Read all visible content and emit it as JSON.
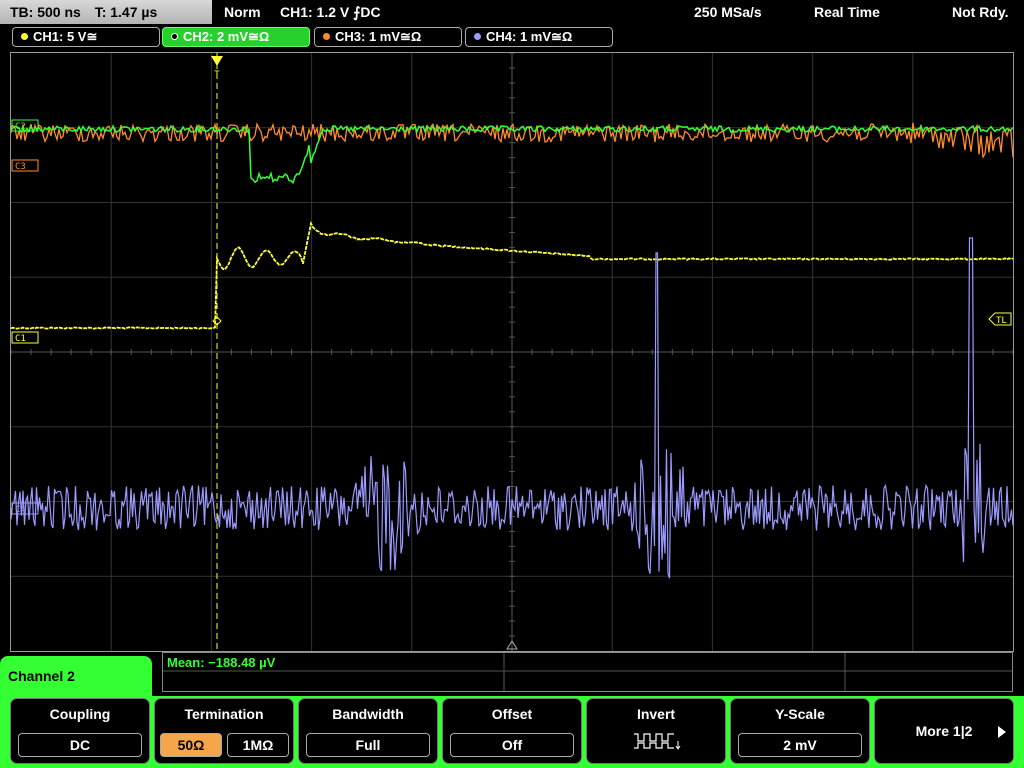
{
  "topbar": {
    "timebase": "TB: 500 ns",
    "trigger_time": "T: 1.47 µs",
    "trigger_mode": "Norm",
    "trigger_info": "CH1: 1.2 V ⨍DC",
    "sample_rate": "250 MSa/s",
    "acq_mode": "Real Time",
    "status": "Not Rdy."
  },
  "channels": [
    {
      "label": "CH1: 5 V≅",
      "color": "#ffff33"
    },
    {
      "label": "CH2: 2 mV≅Ω",
      "color": "#33ff33",
      "active": true
    },
    {
      "label": "CH3: 1 mV≅Ω",
      "color": "#ff8c2a"
    },
    {
      "label": "CH4: 1 mV≅Ω",
      "color": "#9a9aff"
    }
  ],
  "markers": {
    "c1": "C1",
    "c2": "C2",
    "c3": "C3",
    "c4": "C4",
    "tl": "TL",
    "trigger": "T"
  },
  "measurement": {
    "mean": "Mean: −188.48 µV"
  },
  "menu": {
    "title": "Channel 2",
    "coupling": {
      "label": "Coupling",
      "value": "DC"
    },
    "termination": {
      "label": "Termination",
      "opt1": "50Ω",
      "opt2": "1MΩ",
      "selected": "50Ω"
    },
    "bandwidth": {
      "label": "Bandwidth",
      "value": "Full"
    },
    "offset": {
      "label": "Offset",
      "value": "Off"
    },
    "invert": {
      "label": "Invert"
    },
    "yscale": {
      "label": "Y-Scale",
      "value": "2 mV"
    },
    "more": {
      "label": "More 1|2"
    }
  },
  "colors": {
    "ch1": "#ffff33",
    "ch2": "#33ff33",
    "ch3": "#ff8c2a",
    "ch4": "#9a9aff",
    "accent": "#33ff33"
  }
}
